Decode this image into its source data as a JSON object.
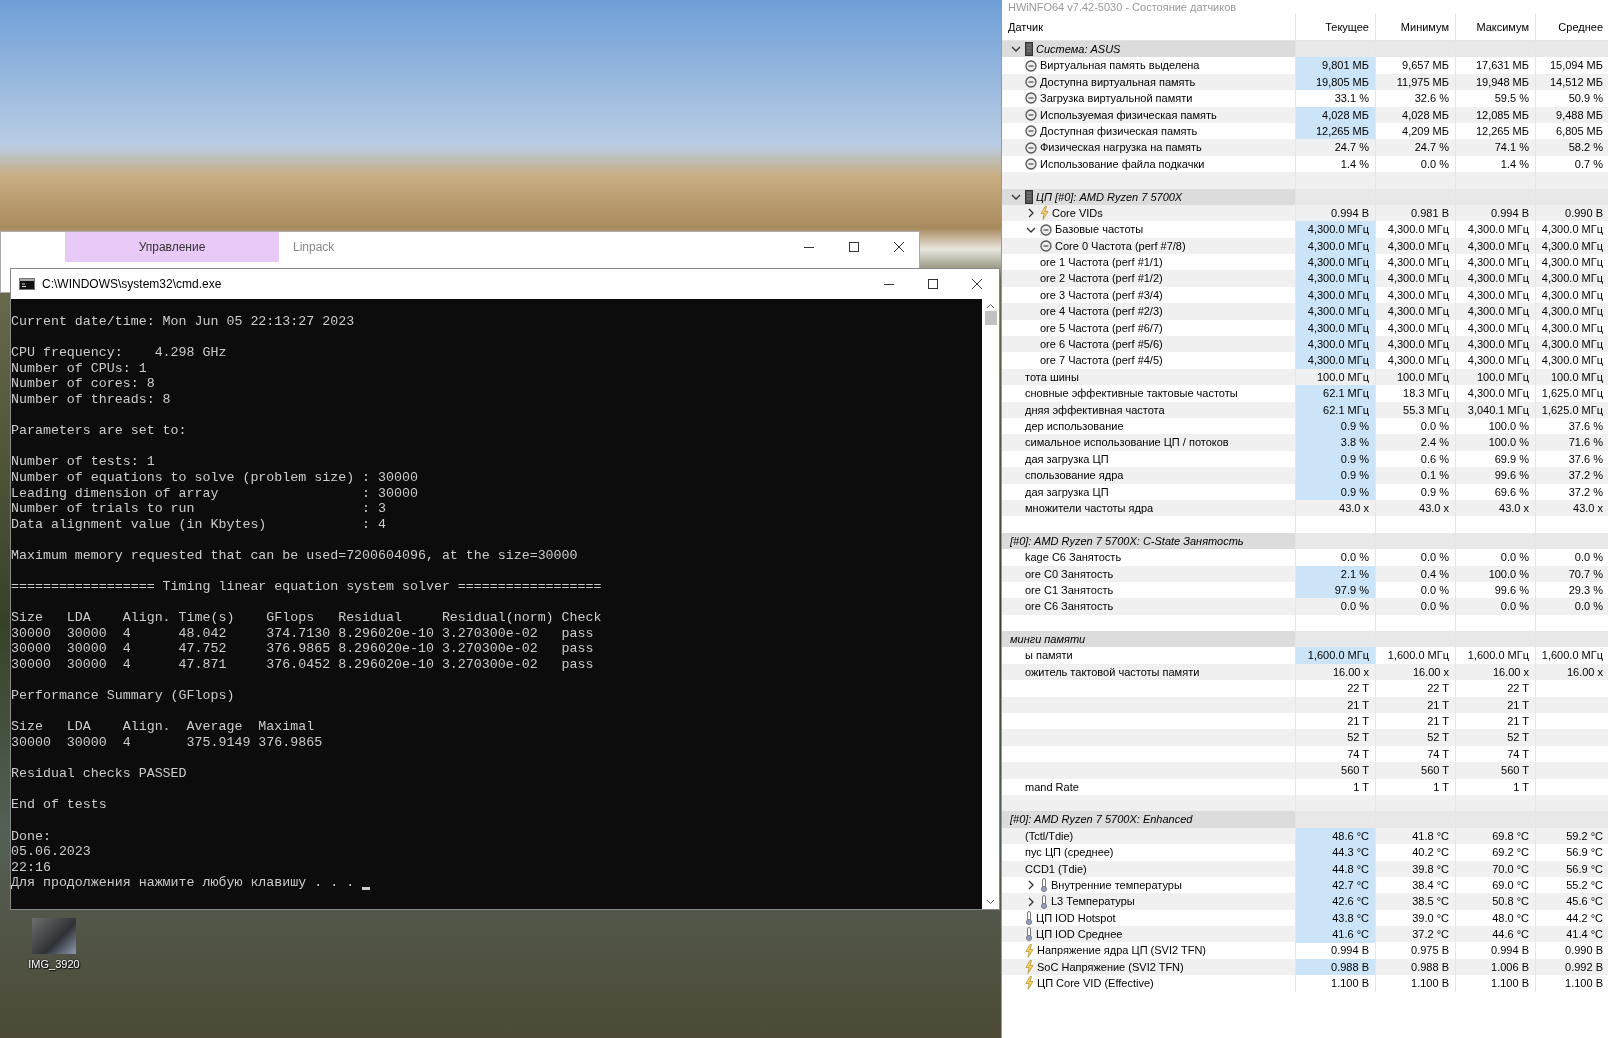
{
  "desktop": {
    "icons": [
      {
        "label": "IMG_3920"
      }
    ]
  },
  "linpack_window": {
    "tabs": [
      {
        "label": "Управление",
        "selected": true
      },
      {
        "label": "Linpack",
        "selected": false
      }
    ]
  },
  "cmd_window": {
    "title": "C:\\WINDOWS\\system32\\cmd.exe",
    "blocks": [
      [
        "Current date/time: Mon Jun 05 22:13:27 2023"
      ],
      [
        "CPU frequency:    4.298 GHz",
        "Number of CPUs: 1",
        "Number of cores: 8",
        "Number of threads: 8"
      ],
      [
        "Parameters are set to:"
      ],
      [
        "Number of tests: 1",
        "Number of equations to solve (problem size) : 30000",
        "Leading dimension of array                  : 30000",
        "Number of trials to run                     : 3",
        "Data alignment value (in Kbytes)            : 4"
      ],
      [
        "Maximum memory requested that can be used=7200604096, at the size=30000"
      ],
      [
        "================== Timing linear equation system solver =================="
      ],
      [
        "Size   LDA    Align. Time(s)    GFlops   Residual     Residual(norm) Check",
        "30000  30000  4      48.042     374.7130 8.296020e-10 3.270300e-02   pass",
        "30000  30000  4      47.752     376.9865 8.296020e-10 3.270300e-02   pass",
        "30000  30000  4      47.871     376.0452 8.296020e-10 3.270300e-02   pass"
      ],
      [
        "Performance Summary (GFlops)"
      ],
      [
        "Size   LDA    Align.  Average  Maximal",
        "30000  30000  4       375.9149 376.9865"
      ],
      [
        "Residual checks PASSED"
      ],
      [
        "End of tests"
      ],
      [
        "Done:",
        "05.06.2023",
        "22:16",
        "Для продолжения нажмите любую клавишу . . ."
      ]
    ]
  },
  "hwinfo": {
    "title": "HWiNFO64 v7.42-5030 - Состояние датчиков",
    "columns": [
      "Датчик",
      "Текущее",
      "Минимум",
      "Максимум",
      "Среднее"
    ],
    "rows": [
      {
        "kind": "device_group",
        "label": "Система: ASUS",
        "expanded": true,
        "children": [
          {
            "kind": "clock_sensor",
            "label": "Виртуальная память выделена",
            "values": [
              "9,801 МБ",
              "9,657 МБ",
              "17,631 МБ",
              "15,094 МБ"
            ],
            "highlighted": true
          },
          {
            "kind": "clock_sensor",
            "label": "Доступна виртуальная память",
            "values": [
              "19,805 МБ",
              "11,975 МБ",
              "19,948 МБ",
              "14,512 МБ"
            ],
            "highlighted": true
          },
          {
            "kind": "clock_sensor",
            "label": "Загрузка виртуальной памяти",
            "values": [
              "33.1 %",
              "32.6 %",
              "59.5 %",
              "50.9 %"
            ],
            "highlighted": false
          },
          {
            "kind": "clock_sensor",
            "label": "Используемая физическая память",
            "values": [
              "4,028 МБ",
              "4,028 МБ",
              "12,085 МБ",
              "9,488 МБ"
            ],
            "highlighted": true
          },
          {
            "kind": "clock_sensor",
            "label": "Доступная физическая память",
            "values": [
              "12,265 МБ",
              "4,209 МБ",
              "12,265 МБ",
              "6,805 МБ"
            ],
            "highlighted": true
          },
          {
            "kind": "clock_sensor",
            "label": "Физическая нагрузка на память",
            "values": [
              "24.7 %",
              "24.7 %",
              "74.1 %",
              "58.2 %"
            ],
            "highlighted": false
          },
          {
            "kind": "clock_sensor",
            "label": "Использование файла подкачки",
            "values": [
              "1.4 %",
              "0.0 %",
              "1.4 %",
              "0.7 %"
            ],
            "highlighted": false
          }
        ]
      },
      {
        "kind": "spacer"
      },
      {
        "kind": "device_group",
        "label": "ЦП [#0]: AMD Ryzen 7 5700X",
        "expanded": true,
        "children": [
          {
            "kind": "voltage_sensor",
            "label": "Core VIDs",
            "expanded": false,
            "values": [
              "0.994 В",
              "0.981 В",
              "0.994 В",
              "0.990 В"
            ],
            "highlighted": false
          },
          {
            "kind": "clock_sensor",
            "label": "Базовые частоты",
            "expanded": true,
            "values": [
              "4,300.0 МГц",
              "4,300.0 МГц",
              "4,300.0 МГц",
              "4,300.0 МГц"
            ],
            "highlighted": true,
            "children": [
              {
                "kind": "clock_sensor",
                "label": "Core 0 Частота (perf #7/8)",
                "values": [
                  "4,300.0 МГц",
                  "4,300.0 МГц",
                  "4,300.0 МГц",
                  "4,300.0 МГц"
                ],
                "highlighted": true
              },
              {
                "kind": "sensor",
                "label": "ore 1 Частота (perf #1/1)",
                "values": [
                  "4,300.0 МГц",
                  "4,300.0 МГц",
                  "4,300.0 МГц",
                  "4,300.0 МГц"
                ],
                "highlighted": true
              },
              {
                "kind": "sensor",
                "label": "ore 2 Частота (perf #1/2)",
                "values": [
                  "4,300.0 МГц",
                  "4,300.0 МГц",
                  "4,300.0 МГц",
                  "4,300.0 МГц"
                ],
                "highlighted": true
              },
              {
                "kind": "sensor",
                "label": "ore 3 Частота (perf #3/4)",
                "values": [
                  "4,300.0 МГц",
                  "4,300.0 МГц",
                  "4,300.0 МГц",
                  "4,300.0 МГц"
                ],
                "highlighted": true
              },
              {
                "kind": "sensor",
                "label": "ore 4 Частота (perf #2/3)",
                "values": [
                  "4,300.0 МГц",
                  "4,300.0 МГц",
                  "4,300.0 МГц",
                  "4,300.0 МГц"
                ],
                "highlighted": true
              },
              {
                "kind": "sensor",
                "label": "ore 5 Частота (perf #6/7)",
                "values": [
                  "4,300.0 МГц",
                  "4,300.0 МГц",
                  "4,300.0 МГц",
                  "4,300.0 МГц"
                ],
                "highlighted": true
              },
              {
                "kind": "sensor",
                "label": "ore 6 Частота (perf #5/6)",
                "values": [
                  "4,300.0 МГц",
                  "4,300.0 МГц",
                  "4,300.0 МГц",
                  "4,300.0 МГц"
                ],
                "highlighted": true
              },
              {
                "kind": "sensor",
                "label": "ore 7 Частота (perf #4/5)",
                "values": [
                  "4,300.0 МГц",
                  "4,300.0 МГц",
                  "4,300.0 МГц",
                  "4,300.0 МГц"
                ],
                "highlighted": true
              }
            ]
          },
          {
            "kind": "sensor",
            "label": "тота шины",
            "values": [
              "100.0 МГц",
              "100.0 МГц",
              "100.0 МГц",
              "100.0 МГц"
            ],
            "highlighted": false
          },
          {
            "kind": "sensor",
            "label": "сновные эффективные тактовые частоты",
            "values": [
              "62.1 МГц",
              "18.3 МГц",
              "4,300.0 МГц",
              "1,625.0 МГц"
            ],
            "highlighted": true
          },
          {
            "kind": "sensor",
            "label": "дняя эффективная частота",
            "values": [
              "62.1 МГц",
              "55.3 МГц",
              "3,040.1 МГц",
              "1,625.0 МГц"
            ],
            "highlighted": true
          },
          {
            "kind": "sensor",
            "label": "дер использование",
            "values": [
              "0.9 %",
              "0.0 %",
              "100.0 %",
              "37.6 %"
            ],
            "highlighted": true
          },
          {
            "kind": "sensor",
            "label": "симальное использование ЦП / потоков",
            "values": [
              "3.8 %",
              "2.4 %",
              "100.0 %",
              "71.6 %"
            ],
            "highlighted": true
          },
          {
            "kind": "sensor",
            "label": "дая загрузка ЦП",
            "values": [
              "0.9 %",
              "0.6 %",
              "69.9 %",
              "37.6 %"
            ],
            "highlighted": true
          },
          {
            "kind": "sensor",
            "label": "спользование ядра",
            "values": [
              "0.9 %",
              "0.1 %",
              "99.6 %",
              "37.2 %"
            ],
            "highlighted": true
          },
          {
            "kind": "sensor",
            "label": "дая загрузка ЦП",
            "values": [
              "0.9 %",
              "0.9 %",
              "69.6 %",
              "37.2 %"
            ],
            "highlighted": true
          },
          {
            "kind": "sensor",
            "label": "множители частоты ядра",
            "values": [
              "43.0 x",
              "43.0 x",
              "43.0 x",
              "43.0 x"
            ],
            "highlighted": false
          }
        ]
      },
      {
        "kind": "spacer"
      },
      {
        "kind": "group",
        "label": "[#0]: AMD Ryzen 7 5700X: C-State Занятость",
        "children": [
          {
            "kind": "sensor",
            "label": "kage C6 Занятость",
            "values": [
              "0.0 %",
              "0.0 %",
              "0.0 %",
              "0.0 %"
            ],
            "highlighted": false
          },
          {
            "kind": "sensor",
            "label": "ore C0 Занятость",
            "values": [
              "2.1 %",
              "0.4 %",
              "100.0 %",
              "70.7 %"
            ],
            "highlighted": true
          },
          {
            "kind": "sensor",
            "label": "ore C1 Занятость",
            "values": [
              "97.9 %",
              "0.0 %",
              "99.6 %",
              "29.3 %"
            ],
            "highlighted": true
          },
          {
            "kind": "sensor",
            "label": "ore C6 Занятость",
            "values": [
              "0.0 %",
              "0.0 %",
              "0.0 %",
              "0.0 %"
            ],
            "highlighted": false
          }
        ]
      },
      {
        "kind": "spacer"
      },
      {
        "kind": "group",
        "label": "минги памяти",
        "children": [
          {
            "kind": "sensor",
            "label": "ы памяти",
            "values": [
              "1,600.0 МГц",
              "1,600.0 МГц",
              "1,600.0 МГц",
              "1,600.0 МГц"
            ],
            "highlighted": true
          },
          {
            "kind": "sensor",
            "label": "ожитель тактовой частоты памяти",
            "values": [
              "16.00 x",
              "16.00 x",
              "16.00 x",
              "16.00 x"
            ],
            "highlighted": false
          },
          {
            "kind": "sensor",
            "values": [
              "22 T",
              "22 T",
              "22 T"
            ],
            "highlighted": false
          },
          {
            "kind": "sensor",
            "values": [
              "21 T",
              "21 T",
              "21 T"
            ],
            "highlighted": false
          },
          {
            "kind": "sensor",
            "values": [
              "21 T",
              "21 T",
              "21 T"
            ],
            "highlighted": false
          },
          {
            "kind": "sensor",
            "values": [
              "52 T",
              "52 T",
              "52 T"
            ],
            "highlighted": false
          },
          {
            "kind": "sensor",
            "values": [
              "74 T",
              "74 T",
              "74 T"
            ],
            "highlighted": false
          },
          {
            "kind": "sensor",
            "values": [
              "560 T",
              "560 T",
              "560 T"
            ],
            "highlighted": false
          },
          {
            "kind": "sensor",
            "label": "mand Rate",
            "values": [
              "1 T",
              "1 T",
              "1 T"
            ],
            "highlighted": false
          }
        ]
      },
      {
        "kind": "spacer"
      },
      {
        "kind": "group",
        "label": "[#0]: AMD Ryzen 7 5700X: Enhanced",
        "children": [
          {
            "kind": "sensor",
            "label": "(Tctl/Tdie)",
            "values": [
              "48.6 °C",
              "41.8 °C",
              "69.8 °C",
              "59.2 °C"
            ],
            "highlighted": true
          },
          {
            "kind": "sensor",
            "label": "пус ЦП (среднее)",
            "values": [
              "44.3 °C",
              "40.2 °C",
              "69.2 °C",
              "56.9 °C"
            ],
            "highlighted": true
          },
          {
            "kind": "sensor",
            "label": "CCD1 (Tdie)",
            "values": [
              "44.8 °C",
              "39.8 °C",
              "70.0 °C",
              "56.9 °C"
            ],
            "highlighted": true
          },
          {
            "kind": "temperature_sensor",
            "label": "Внутренние температуры",
            "expanded": false,
            "values": [
              "42.7 °C",
              "38.4 °C",
              "69.0 °C",
              "55.2 °C"
            ],
            "highlighted": true
          },
          {
            "kind": "temperature_sensor",
            "label": "L3 Температуры",
            "expanded": false,
            "values": [
              "42.6 °C",
              "38.5 °C",
              "50.8 °C",
              "45.6 °C"
            ],
            "highlighted": true
          },
          {
            "kind": "temperature_sensor",
            "label": "ЦП IOD Hotspot",
            "values": [
              "43.8 °C",
              "39.0 °C",
              "48.0 °C",
              "44.2 °C"
            ],
            "highlighted": true
          },
          {
            "kind": "temperature_sensor",
            "label": "ЦП IOD Среднее",
            "values": [
              "41.6 °C",
              "37.2 °C",
              "44.6 °C",
              "41.4 °C"
            ],
            "highlighted": true
          },
          {
            "kind": "voltage_sensor",
            "label": "Напряжение ядра ЦП (SVI2 TFN)",
            "values": [
              "0.994 В",
              "0.975 В",
              "0.994 В",
              "0.990 В"
            ],
            "highlighted": false
          },
          {
            "kind": "voltage_sensor",
            "label": "SoC Напряжение (SVI2 TFN)",
            "values": [
              "0.988 В",
              "0.988 В",
              "1.006 В",
              "0.992 В"
            ],
            "highlighted": true
          },
          {
            "kind": "voltage_sensor",
            "label": "ЦП Core VID (Effective)",
            "values": [
              "1.100 В",
              "1.100 В",
              "1.100 В",
              "1.100 В"
            ],
            "highlighted": false
          }
        ]
      }
    ]
  }
}
